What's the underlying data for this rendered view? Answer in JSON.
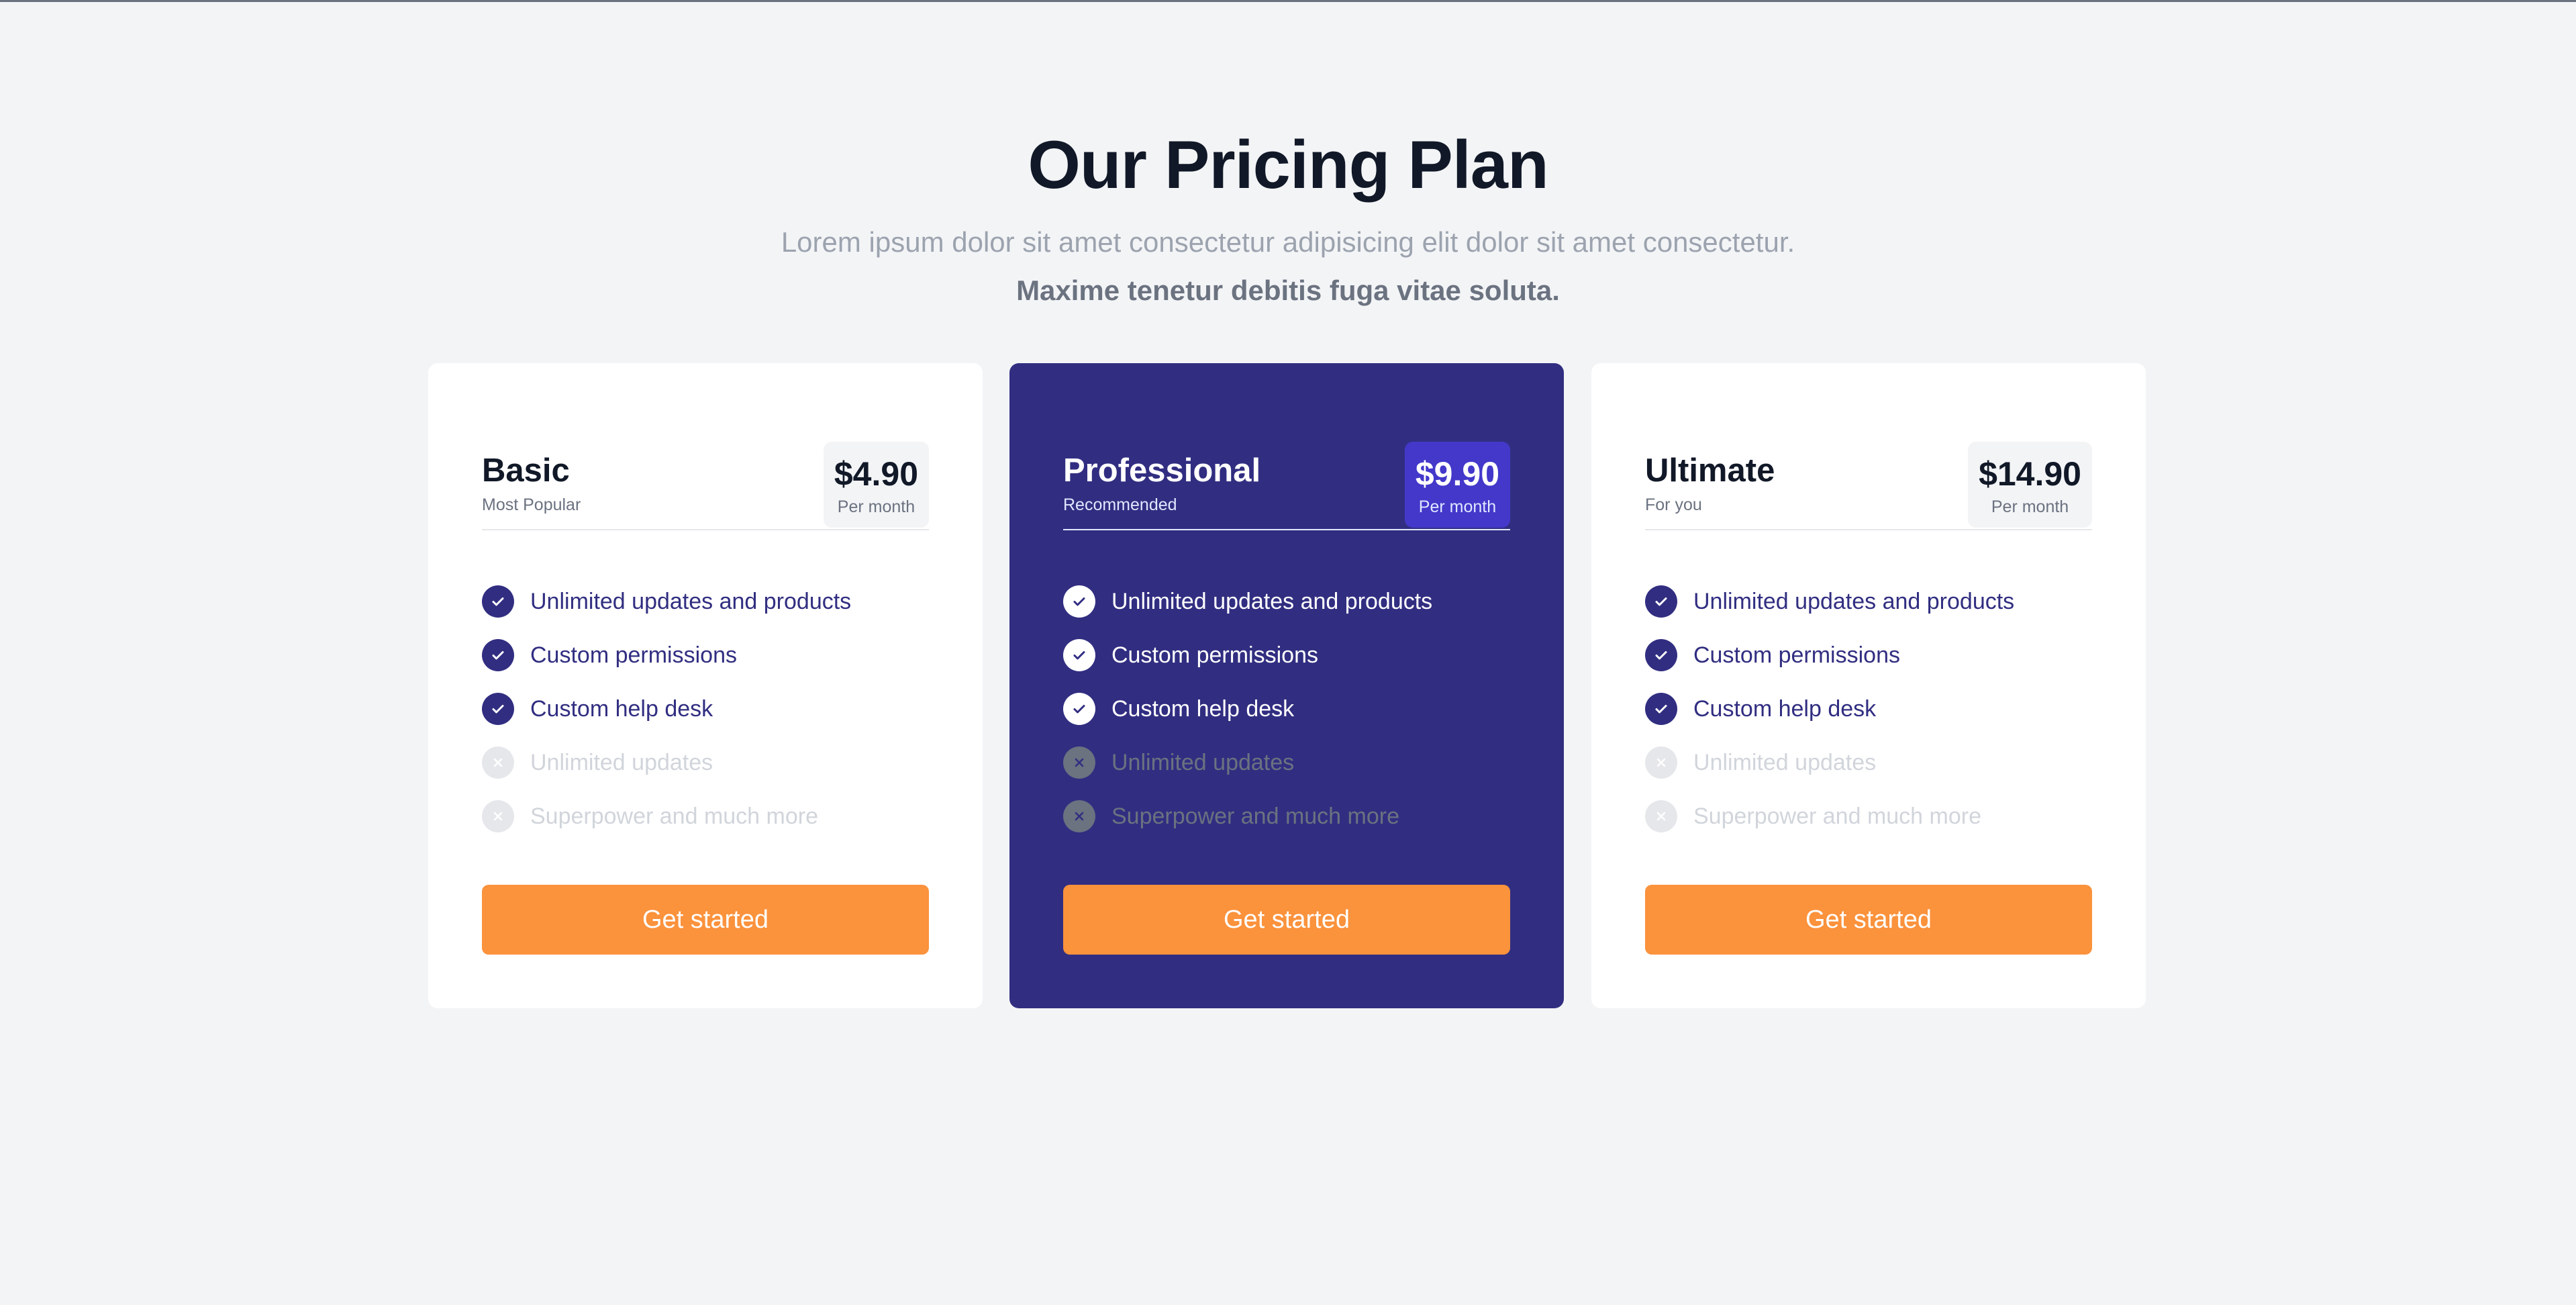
{
  "header": {
    "title": "Our Pricing Plan",
    "subtitle": "Lorem ipsum dolor sit amet consectetur adipisicing elit dolor sit amet consectetur.",
    "subtitle_bold": "Maxime tenetur debitis fuga vitae soluta."
  },
  "colors": {
    "background": "#f3f4f6",
    "brand_indigo": "#312e81",
    "price_badge_featured": "#4338ca",
    "cta_orange": "#fb923c",
    "heading": "#111827"
  },
  "icons": {
    "included": "check-icon",
    "excluded": "x-icon"
  },
  "plans": [
    {
      "name": "Basic",
      "subtitle": "Most Popular",
      "price": "$4.90",
      "period": "Per month",
      "features": [
        {
          "label": "Unlimited updates and products",
          "included": true
        },
        {
          "label": "Custom permissions",
          "included": true
        },
        {
          "label": "Custom help desk",
          "included": true
        },
        {
          "label": "Unlimited updates",
          "included": false
        },
        {
          "label": "Superpower and much more",
          "included": false
        }
      ],
      "cta": "Get started"
    },
    {
      "name": "Professional",
      "subtitle": "Recommended",
      "price": "$9.90",
      "period": "Per month",
      "features": [
        {
          "label": "Unlimited updates and products",
          "included": true
        },
        {
          "label": "Custom permissions",
          "included": true
        },
        {
          "label": "Custom help desk",
          "included": true
        },
        {
          "label": "Unlimited updates",
          "included": false
        },
        {
          "label": "Superpower and much more",
          "included": false
        }
      ],
      "cta": "Get started"
    },
    {
      "name": "Ultimate",
      "subtitle": "For you",
      "price": "$14.90",
      "period": "Per month",
      "features": [
        {
          "label": "Unlimited updates and products",
          "included": true
        },
        {
          "label": "Custom permissions",
          "included": true
        },
        {
          "label": "Custom help desk",
          "included": true
        },
        {
          "label": "Unlimited updates",
          "included": false
        },
        {
          "label": "Superpower and much more",
          "included": false
        }
      ],
      "cta": "Get started"
    }
  ]
}
